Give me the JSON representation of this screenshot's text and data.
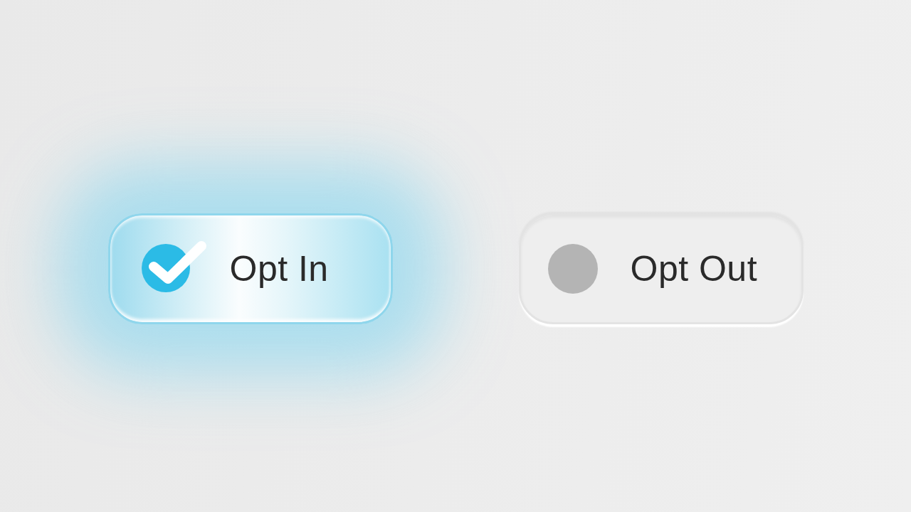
{
  "options": [
    {
      "label": "Opt In",
      "selected": true
    },
    {
      "label": "Opt Out",
      "selected": false
    }
  ]
}
